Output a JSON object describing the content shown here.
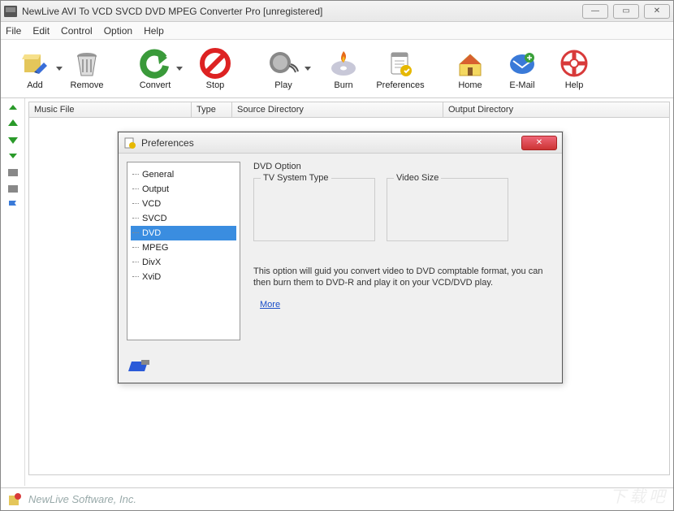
{
  "window": {
    "title": "NewLive AVI To VCD SVCD DVD MPEG Converter Pro  [unregistered]"
  },
  "menu": {
    "file": "File",
    "edit": "Edit",
    "control": "Control",
    "option": "Option",
    "help": "Help"
  },
  "toolbar": {
    "add": "Add",
    "remove": "Remove",
    "convert": "Convert",
    "stop": "Stop",
    "play": "Play",
    "burn": "Burn",
    "preferences": "Preferences",
    "home": "Home",
    "email": "E-Mail",
    "help": "Help"
  },
  "columns": {
    "music_file": "Music File",
    "type": "Type",
    "source_dir": "Source Directory",
    "output_dir": "Output Directory"
  },
  "status": {
    "company": "NewLive Software, Inc."
  },
  "dialog": {
    "title": "Preferences",
    "tree": {
      "general": "General",
      "output": "Output",
      "vcd": "VCD",
      "svcd": "SVCD",
      "dvd": "DVD",
      "mpeg": "MPEG",
      "divx": "DivX",
      "xvid": "XviD"
    },
    "pane": {
      "heading": "DVD Option",
      "group_tv": "TV System Type",
      "group_size": "Video Size",
      "desc": "This option will guid you convert video to DVD comptable format, you can then burn them to DVD-R and play it on your VCD/DVD play.",
      "more": "More"
    }
  }
}
